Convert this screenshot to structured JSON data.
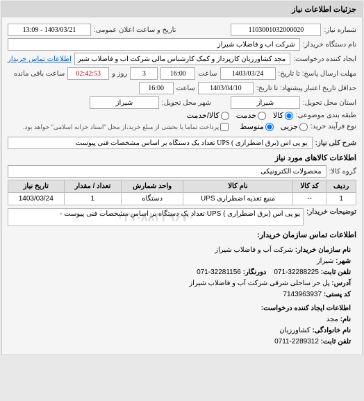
{
  "header": {
    "title": "جزئیات اطلاعات نیاز"
  },
  "fields": {
    "need_no_label": "شماره نیاز:",
    "need_no": "1103001032000020",
    "announce_label": "تاریخ و ساعت اعلان عمومی:",
    "announce": "1403/03/21 - 13:09",
    "org_label": "نام دستگاه خریدار:",
    "org": "شرکت آب و فاضلاب شیراز",
    "creator_label": "ایجاد کننده درخواست:",
    "creator": "مجد کشاورزیان کارپرداز و کمک کارشناس مالی شرکت آب و فاضلاب شیراز",
    "contact_link": "اطلاعات تماس خریدار",
    "deadline_label": "مهلت ارسال پاسخ: تا تاریخ:",
    "deadline_date": "1403/03/24",
    "deadline_hour_label": "ساعت",
    "deadline_hour": "16:00",
    "days_label": "روز و",
    "days": "3",
    "remain_label": "ساعت باقی مانده",
    "remain": "02:42:53",
    "validity_label": "حداقل تاریخ اعتبار پیشنهاد: تا تاریخ:",
    "validity_date": "1403/04/10",
    "validity_hour": "16:00",
    "delivery_state_label": "استان محل تحویل:",
    "delivery_state": "شیراز",
    "delivery_city_label": "شهر محل تحویل:",
    "delivery_city": "شیراز",
    "type_label": "طبقه بندی موضوعی:",
    "type_opts": {
      "goods": "کالا",
      "service": "خدمت",
      "both": "کالا/خدمت"
    },
    "process_label": "نوع فرآیند خرید:",
    "process_opts": {
      "small": "جزیی",
      "medium": "متوسط"
    },
    "payment_label": "پرداخت تماما یا بخشی از مبلغ خرید،از محل \"اسناد خزانه اسلامی\" خواهد بود.",
    "summary_label": "شرح کلی نیاز:",
    "summary": "یو پی اس (برق اضطراری ) UPS تعداد یک دستگاه بر اساس مشخصات فنی پیوست"
  },
  "goods": {
    "title": "اطلاعات کالاهای مورد نیاز",
    "group_label": "گروه کالا:",
    "group": "محصولات الکترونیکی",
    "headers": {
      "row": "ردیف",
      "code": "کد کالا",
      "name": "نام کالا",
      "unit": "واحد شمارش",
      "qty": "تعداد / مقدار",
      "date": "تاریخ نیاز"
    },
    "rows": [
      {
        "row": "1",
        "code": "--",
        "name": "منبع تغذیه اضطراری UPS",
        "unit": "دستگاه",
        "qty": "1",
        "date": "1403/03/24"
      }
    ],
    "buyer_note": "توضیحات خریدار:",
    "buyer_note_text": "یو پی اس (برق اضطراری ) UPS تعداد یک دستگاه بر اساس مشخصات فنی پیوست -"
  },
  "contact": {
    "title": "اطلاعات تماس سازمان خریدار:",
    "org_name_l": "نام سازمان خریدار:",
    "org_name": "شرکت آب و فاضلاب شیراز",
    "city_l": "شهر:",
    "city": "شیراز",
    "tel_l": "تلفن ثابت:",
    "tel": "32288225-071",
    "fax_l": "دورنگار:",
    "fax": "32281156-071",
    "addr_l": "آدرس:",
    "addr": "پل حر ساحلی شرقی شرکت آب و فاضلاب شیراز",
    "post_l": "کد پستی:",
    "post": "7143963937",
    "creator_title": "اطلاعات ایجاد کننده درخواست:",
    "name_l": "نام:",
    "name": "مجد",
    "family_l": "نام خانوادگی:",
    "family": "کشاورزیان",
    "tel2_l": "تلفن ثابت:",
    "tel2": "2289312-0711"
  }
}
